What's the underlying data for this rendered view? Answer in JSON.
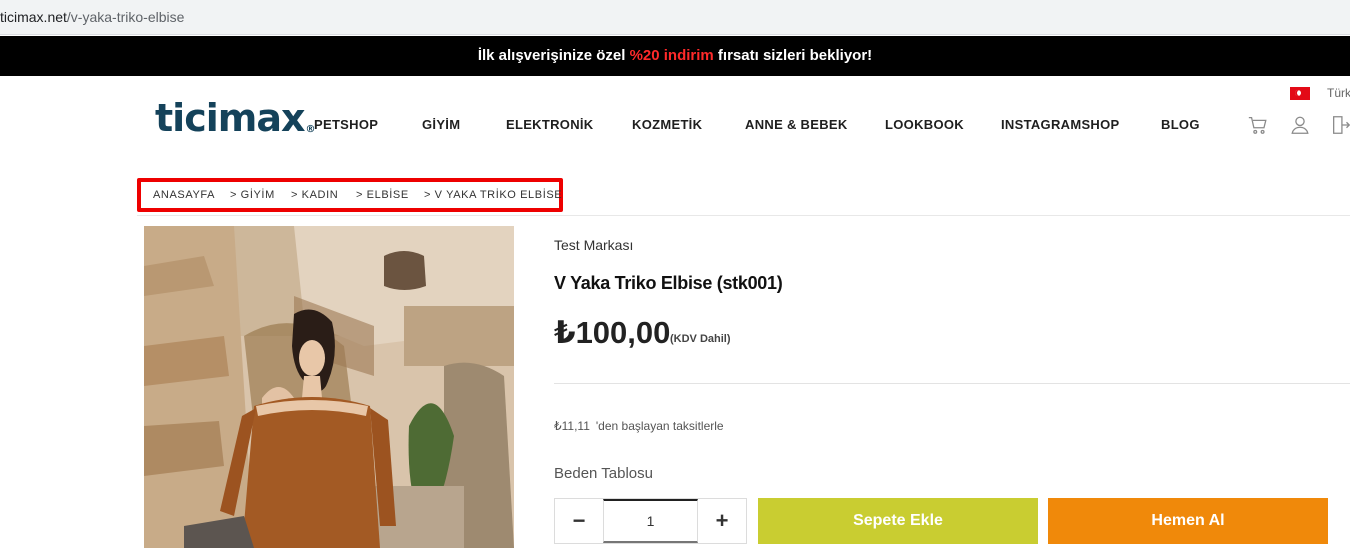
{
  "browser": {
    "domain": "ticimax.net",
    "path": "/v-yaka-triko-elbise"
  },
  "promo": {
    "before": "İlk alışverişinize özel ",
    "highlight": "%20 indirim",
    "after": " fırsatı sizleri bekliyor!"
  },
  "header": {
    "logo_text": "ticimax",
    "logo_mark": "®",
    "nav": [
      "PETSHOP",
      "GİYİM",
      "ELEKTRONİK",
      "KOZMETİK",
      "ANNE & BEBEK",
      "LOOKBOOK",
      "INSTAGRAMSHOP",
      "BLOG"
    ],
    "language": "Türk",
    "icons": [
      "cart-icon",
      "user-icon",
      "logout-icon"
    ]
  },
  "breadcrumb": [
    "ANASAYFA",
    "> GİYİM",
    "> KADIN",
    "> ELBİSE",
    "> V YAKA TRİKO ELBİSE"
  ],
  "product": {
    "brand": "Test Markası",
    "title": "V Yaka Triko Elbise (stk001)",
    "price": "₺100,00",
    "vat": "(KDV Dahil)",
    "installment_amount": "₺11,11",
    "installment_text": "'den başlayan taksitlerle",
    "size_table": "Beden Tablosu",
    "quantity": "1",
    "minus": "−",
    "plus": "+",
    "add_to_cart": "Sepete Ekle",
    "buy_now": "Hemen Al"
  },
  "colors": {
    "accent_red": "#ff2a2a",
    "logo_blue": "#14425a",
    "add_to_cart": "#c9cd31",
    "buy_now": "#f0890a"
  }
}
